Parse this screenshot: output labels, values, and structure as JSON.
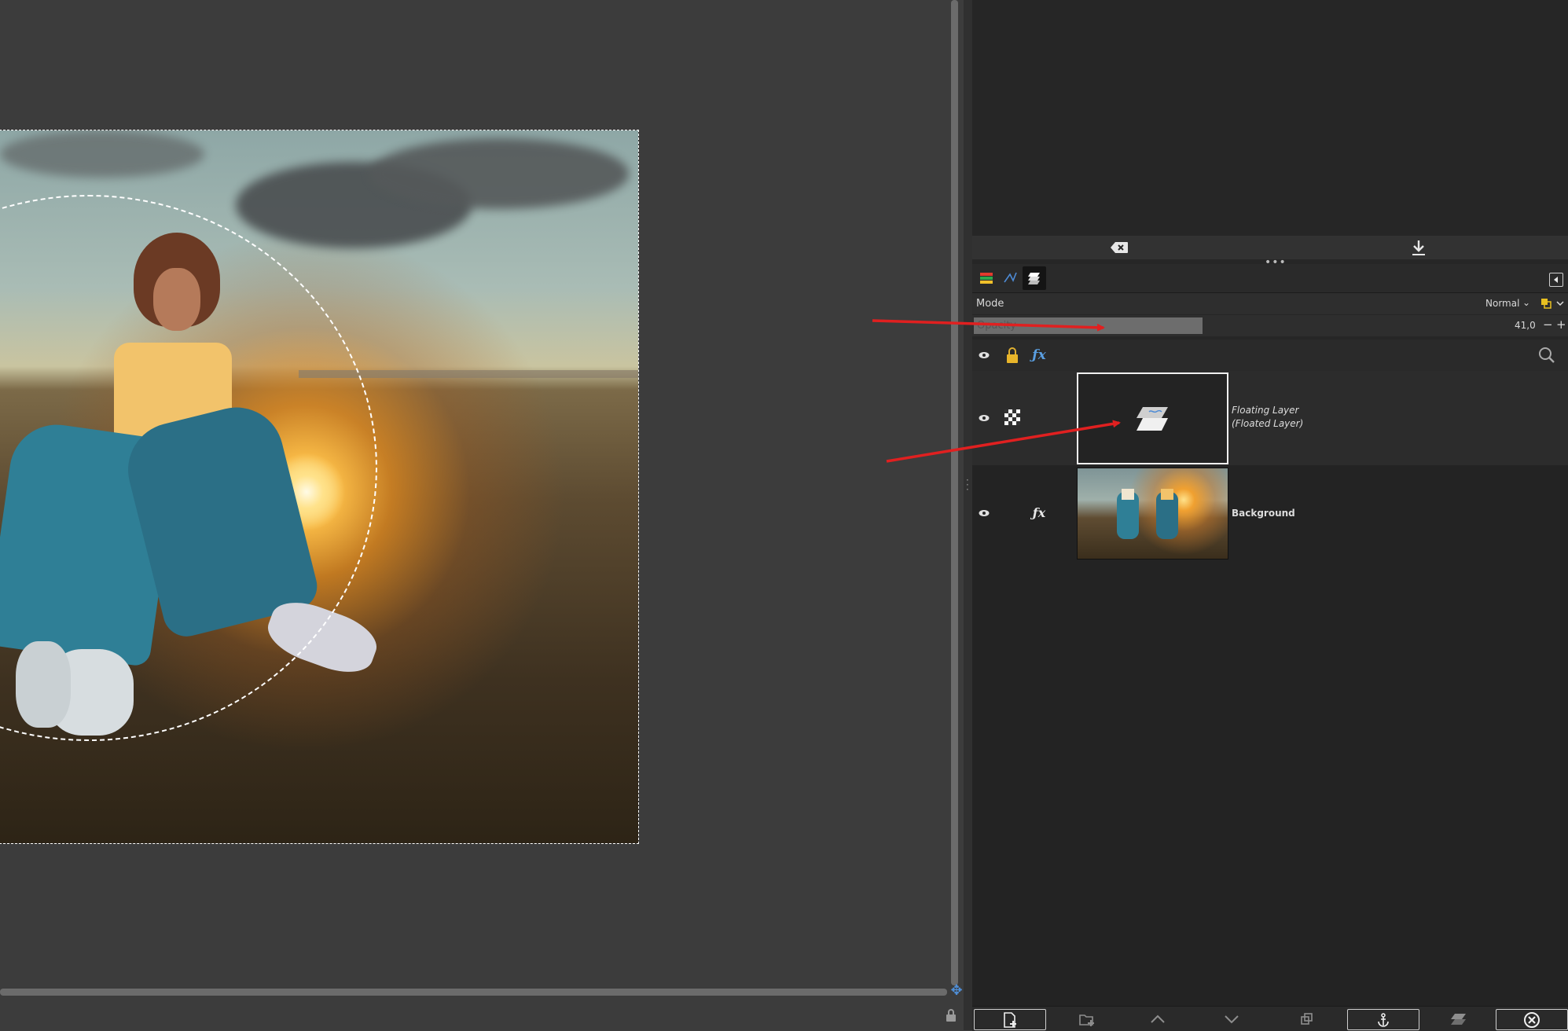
{
  "layers_panel": {
    "mode_label": "Mode",
    "mode_value": "Normal",
    "opacity_label": "Opacity",
    "opacity_value": "41,0",
    "opacity_fraction": 0.41,
    "minus_label": "−",
    "plus_label": "+"
  },
  "layers": [
    {
      "name_line1": "Floating Layer",
      "name_line2": "(Floated Layer)",
      "selected": true
    },
    {
      "name_line1": "Background",
      "selected": false
    }
  ],
  "icons": {
    "tabs": [
      "layers-tab-icon",
      "paths-tab-icon",
      "channels-tab-icon"
    ],
    "locks": [
      "visibility-eye-icon",
      "lock-icon",
      "fx-icon",
      "search-icon"
    ],
    "bottom": [
      "new-layer-icon",
      "new-layer-group-icon",
      "raise-layer-icon",
      "lower-layer-icon",
      "duplicate-layer-icon",
      "anchor-layer-icon",
      "merge-down-icon",
      "delete-layer-icon"
    ]
  },
  "colors": {
    "annotation_arrow": "#e02020",
    "canvas_bg": "#3c3c3c",
    "dock_bg": "#262626"
  }
}
